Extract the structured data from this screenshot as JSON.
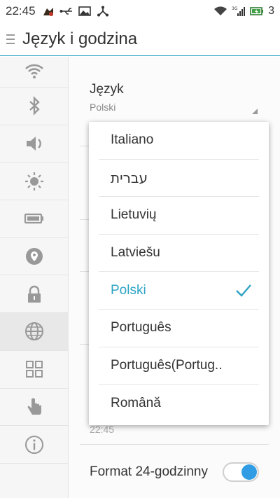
{
  "status_bar": {
    "time": "22:45",
    "battery_text": "3",
    "network_label": "3G",
    "icons_left": [
      "app-notification-icon",
      "usb-icon",
      "image-icon",
      "network-share-icon"
    ],
    "icons_right": [
      "wifi-icon",
      "signal-icon",
      "battery-icon"
    ]
  },
  "header": {
    "title": "Język i godzina"
  },
  "sidebar": {
    "items": [
      {
        "icon": "wifi-icon"
      },
      {
        "icon": "bluetooth-icon"
      },
      {
        "icon": "volume-icon"
      },
      {
        "icon": "brightness-icon"
      },
      {
        "icon": "battery-icon"
      },
      {
        "icon": "location-icon"
      },
      {
        "icon": "lock-icon"
      },
      {
        "icon": "globe-icon",
        "active": true
      },
      {
        "icon": "apps-grid-icon"
      },
      {
        "icon": "gesture-hand-icon"
      },
      {
        "icon": "info-icon"
      }
    ]
  },
  "main": {
    "language_label": "Język",
    "language_value": "Polski",
    "time_value": "22:45",
    "format_24h_label": "Format 24-godzinny",
    "format_24h_enabled": true
  },
  "dropdown": {
    "options": [
      {
        "label": "Italiano"
      },
      {
        "label": "עברית"
      },
      {
        "label": "Lietuvių"
      },
      {
        "label": "Latviešu"
      },
      {
        "label": "Polski",
        "selected": true
      },
      {
        "label": "Português"
      },
      {
        "label": "Português(Portug.."
      },
      {
        "label": "Română"
      }
    ]
  },
  "colors": {
    "accent": "#2ea3c4",
    "toggle_on": "#2f9ce3",
    "header_line": "#3aa7c8"
  }
}
